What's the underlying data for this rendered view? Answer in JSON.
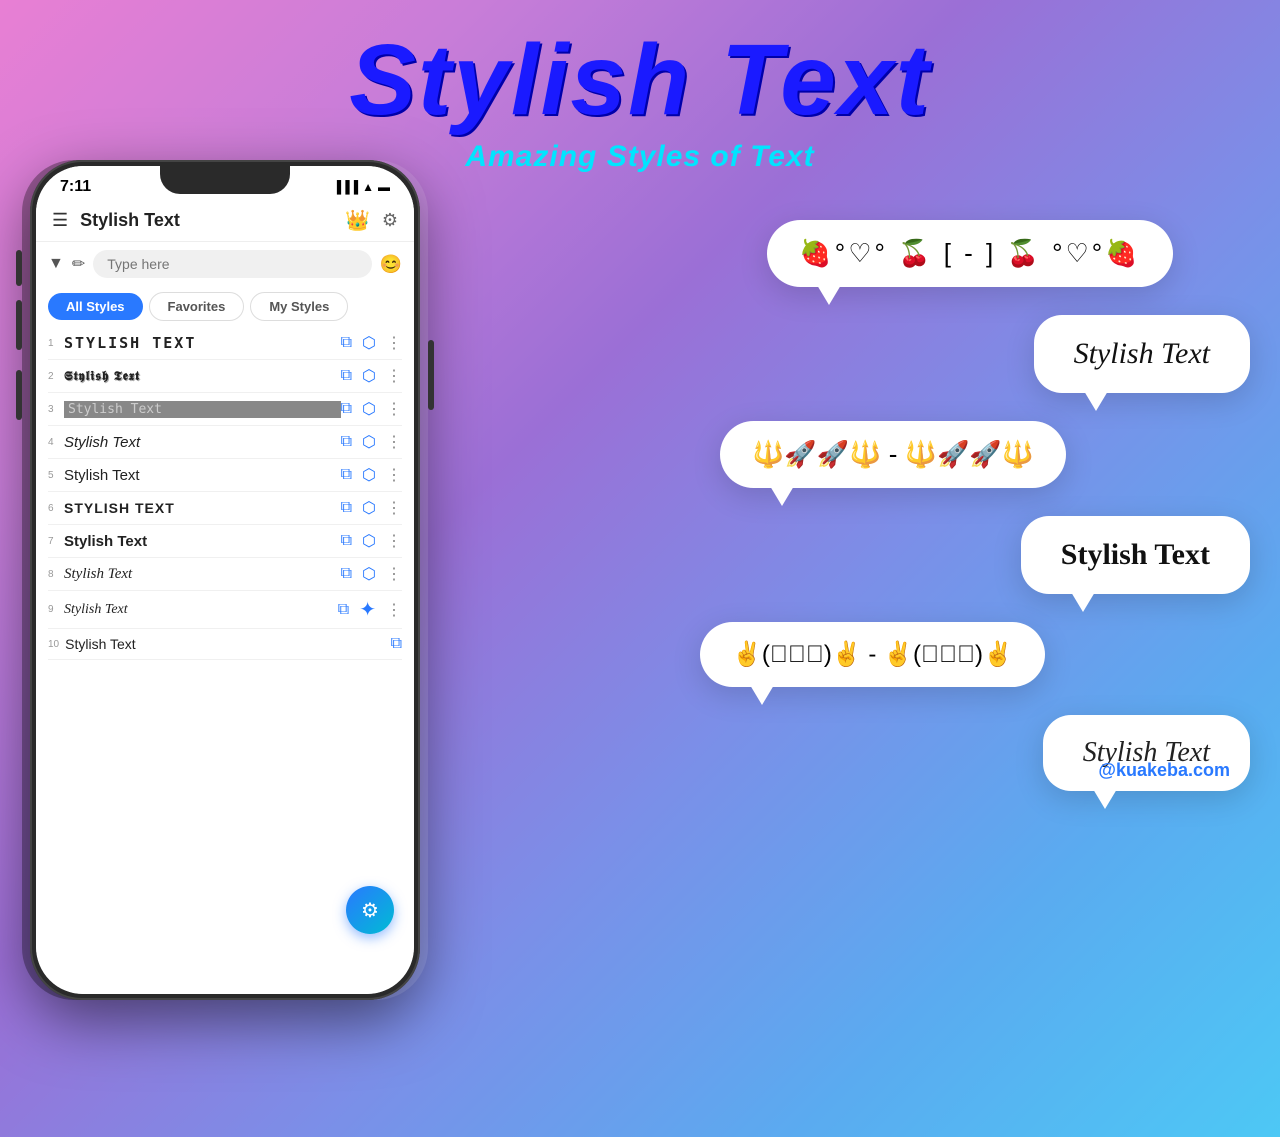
{
  "page": {
    "title": "Stylish Text",
    "subtitle": "Amazing Styles of Text",
    "watermark": "@kuakeba.com"
  },
  "phone": {
    "status_time": "7:11",
    "app_title": "Stylish Text",
    "search_placeholder": "Type here",
    "tabs": [
      {
        "label": "All Styles",
        "active": true
      },
      {
        "label": "Favorites",
        "active": false
      },
      {
        "label": "My Styles",
        "active": false
      }
    ],
    "styles": [
      {
        "number": "1",
        "text": "STYLISH TEXT"
      },
      {
        "number": "2",
        "text": "𝕊𝕥𝕪𝕝𝕚𝕤𝕙 𝕋𝕖𝕩𝕥"
      },
      {
        "number": "3",
        "text": "Stylish Text"
      },
      {
        "number": "4",
        "text": "Stylish Text"
      },
      {
        "number": "5",
        "text": "Stylish Text"
      },
      {
        "number": "6",
        "text": "STYLISH TEXT"
      },
      {
        "number": "7",
        "text": "Stylish Text"
      },
      {
        "number": "8",
        "text": "Stylish Text"
      },
      {
        "number": "9",
        "text": "Stylish Text"
      },
      {
        "number": "10",
        "text": "Stylish Text"
      }
    ]
  },
  "bubbles": [
    {
      "text": "🍓°♡° 🍒 [ - ] 🍒 °♡°🍓",
      "class": "bubble-text-1"
    },
    {
      "text": "Stylish Text",
      "class": "bubble-text-2"
    },
    {
      "text": "🔱🚀🚀🔱 - 🔱🚀🚀🔱",
      "class": "bubble-text-3"
    },
    {
      "text": "Stylish Text",
      "class": "bubble-text-4"
    },
    {
      "text": "✌(ﾟ◡ﾟ)✌ - ✌(ﾟ◡ﾟ)✌",
      "class": "bubble-text-5"
    },
    {
      "text": "Stylish Text",
      "class": "bubble-text-6"
    }
  ]
}
